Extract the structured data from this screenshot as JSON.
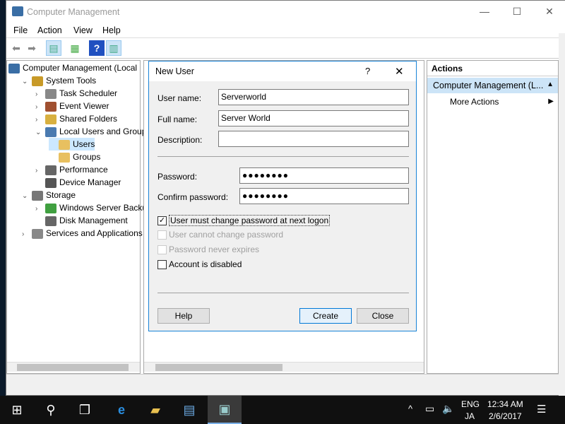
{
  "window": {
    "title": "Computer Management",
    "minimize": "—",
    "maximize": "☐",
    "close": "✕"
  },
  "menu": [
    "File",
    "Action",
    "View",
    "Help"
  ],
  "tree": [
    {
      "label": "Computer Management (Local",
      "toggle": "",
      "level": 0,
      "color": "#3a6ea5"
    },
    {
      "label": "System Tools",
      "toggle": "⌄",
      "level": 1,
      "color": "#c89a28"
    },
    {
      "label": "Task Scheduler",
      "toggle": "›",
      "level": 2,
      "color": "#888"
    },
    {
      "label": "Event Viewer",
      "toggle": "›",
      "level": 2,
      "color": "#a05030"
    },
    {
      "label": "Shared Folders",
      "toggle": "›",
      "level": 2,
      "color": "#d8b040"
    },
    {
      "label": "Local Users and Groups",
      "toggle": "⌄",
      "level": 2,
      "color": "#4a7ab0"
    },
    {
      "label": "Users",
      "toggle": "",
      "level": 3,
      "color": "#e8c060"
    },
    {
      "label": "Groups",
      "toggle": "",
      "level": 3,
      "color": "#e8c060"
    },
    {
      "label": "Performance",
      "toggle": "›",
      "level": 2,
      "color": "#666"
    },
    {
      "label": "Device Manager",
      "toggle": "",
      "level": 2,
      "color": "#555"
    },
    {
      "label": "Storage",
      "toggle": "⌄",
      "level": 1,
      "color": "#777"
    },
    {
      "label": "Windows Server Backup",
      "toggle": "›",
      "level": 2,
      "color": "#40a040"
    },
    {
      "label": "Disk Management",
      "toggle": "",
      "level": 2,
      "color": "#666"
    },
    {
      "label": "Services and Applications",
      "toggle": "›",
      "level": 1,
      "color": "#888"
    }
  ],
  "actions": {
    "header": "Actions",
    "section": "Computer Management (L...",
    "section_arrow": "▲",
    "more": "More Actions",
    "more_arrow": "▶"
  },
  "dialog": {
    "title": "New User",
    "help": "?",
    "close": "✕",
    "user_name_label": "User name:",
    "user_name": "Serverworld",
    "full_name_label": "Full name:",
    "full_name": "Server World",
    "description_label": "Description:",
    "description": "",
    "password_label": "Password:",
    "password": "●●●●●●●●",
    "confirm_label": "Confirm password:",
    "confirm": "●●●●●●●●",
    "checkboxes": [
      {
        "label": "User must change password at next logon",
        "checked": true,
        "disabled": false
      },
      {
        "label": "User cannot change password",
        "checked": false,
        "disabled": true
      },
      {
        "label": "Password never expires",
        "checked": false,
        "disabled": true
      },
      {
        "label": "Account is disabled",
        "checked": false,
        "disabled": false
      }
    ],
    "help_btn": "Help",
    "create_btn": "Create",
    "close_btn": "Close"
  },
  "taskbar": {
    "lang_top": "ENG",
    "lang_bottom": "JA",
    "time": "12:34 AM",
    "date": "2/6/2017"
  }
}
